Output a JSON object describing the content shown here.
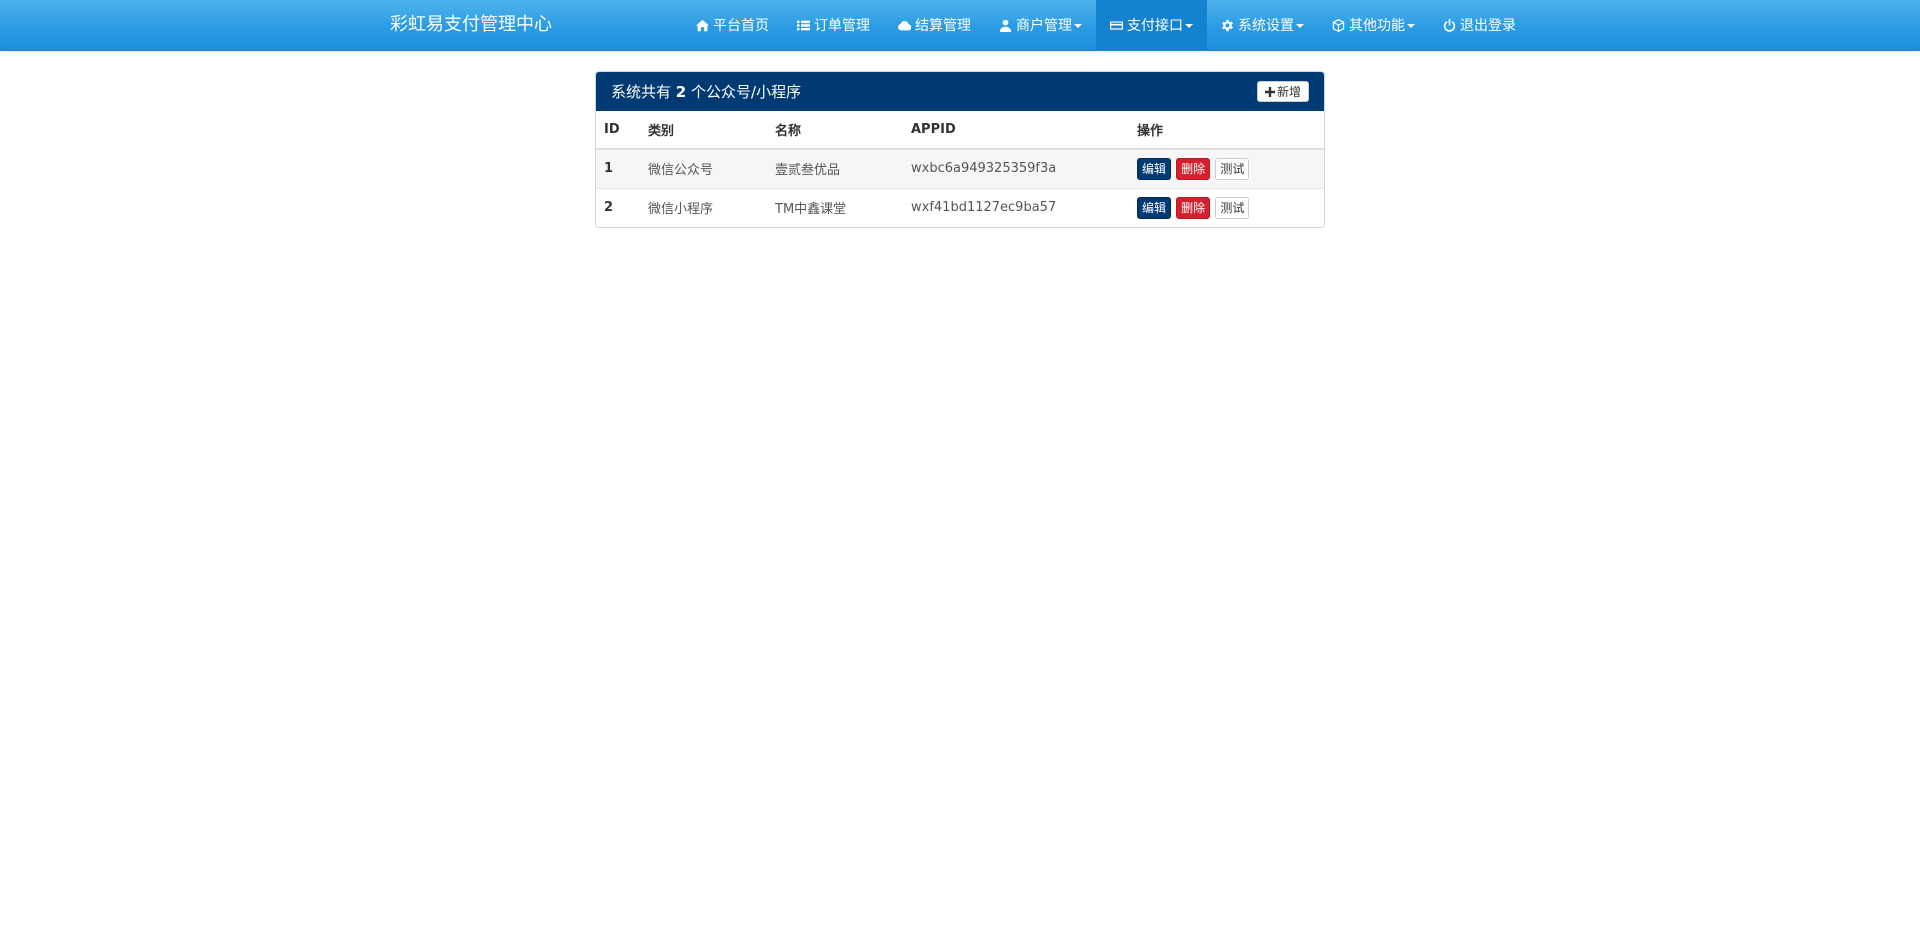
{
  "brand": "彩虹易支付管理中心",
  "nav": [
    {
      "label": "平台首页",
      "icon": "home-icon",
      "dropdown": false
    },
    {
      "label": "订单管理",
      "icon": "list-icon",
      "dropdown": false
    },
    {
      "label": "结算管理",
      "icon": "cloud-icon",
      "dropdown": false
    },
    {
      "label": "商户管理",
      "icon": "user-icon",
      "dropdown": true
    },
    {
      "label": "支付接口",
      "icon": "credit-card-icon",
      "dropdown": true,
      "active": true
    },
    {
      "label": "系统设置",
      "icon": "gear-icon",
      "dropdown": true
    },
    {
      "label": "其他功能",
      "icon": "cube-icon",
      "dropdown": true
    },
    {
      "label": "退出登录",
      "icon": "power-icon",
      "dropdown": false
    }
  ],
  "panel": {
    "title_prefix": "系统共有",
    "count": "2",
    "title_suffix": "个公众号/小程序",
    "add_label": "新增"
  },
  "table": {
    "headers": [
      "ID",
      "类别",
      "名称",
      "APPID",
      "操作"
    ],
    "rows": [
      {
        "id": "1",
        "type": "微信公众号",
        "name": "壹贰叁优品",
        "appid": "wxbc6a949325359f3a"
      },
      {
        "id": "2",
        "type": "微信小程序",
        "name": "TM中鑫课堂",
        "appid": "wxf41bd1127ec9ba57"
      }
    ],
    "actions": {
      "edit": "编辑",
      "delete": "删除",
      "test": "测试"
    }
  },
  "colors": {
    "navbar": "#2a9be3",
    "panel_heading": "#003a73",
    "edit_button": "#003a73",
    "delete_button": "#d5202e"
  }
}
